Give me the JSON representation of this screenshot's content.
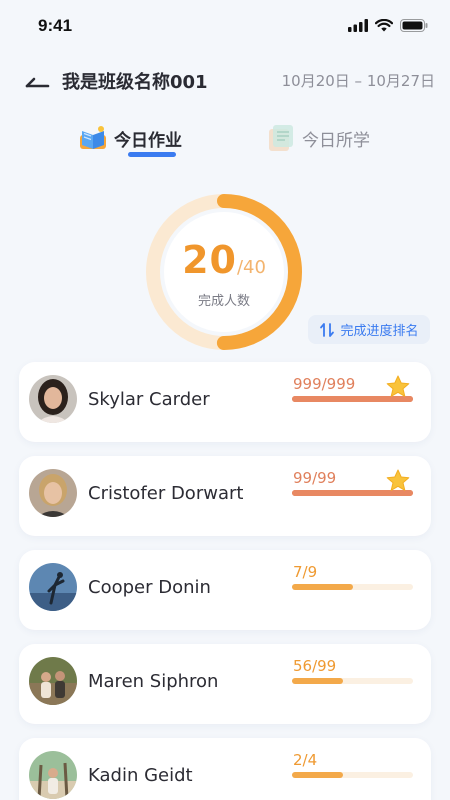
{
  "status": {
    "time": "9:41"
  },
  "header": {
    "class_name": "我是班级名称001",
    "date_range": "10月20日 – 10月27日"
  },
  "tabs": [
    {
      "label": "今日作业",
      "active": true,
      "icon": "book-icon"
    },
    {
      "label": "今日所学",
      "active": false,
      "icon": "notebook-icon"
    }
  ],
  "summary": {
    "completed": "20",
    "total": "/40",
    "caption": "完成人数",
    "completion_fraction": 0.5
  },
  "rank_button": {
    "label": "完成进度排名",
    "icon": "sort-icon"
  },
  "colors": {
    "accent_blue": "#3a7bf0",
    "ring_orange": "#f6a63a",
    "ring_track": "#fbe9d2",
    "complete_bar": "#e88862",
    "progress_bar": "#f3a94a",
    "bar_track": "#fbf0e2",
    "star": "#f9c33b"
  },
  "students": [
    {
      "name": "Skylar Carder",
      "progress": "999/999",
      "fraction": 1.0,
      "complete": true
    },
    {
      "name": "Cristofer Dorwart",
      "progress": "99/99",
      "fraction": 1.0,
      "complete": true
    },
    {
      "name": "Cooper Donin",
      "progress": "7/9",
      "fraction": 0.5,
      "complete": false
    },
    {
      "name": "Maren Siphron",
      "progress": "56/99",
      "fraction": 0.42,
      "complete": false
    },
    {
      "name": "Kadin Geidt",
      "progress": "2/4",
      "fraction": 0.42,
      "complete": false
    }
  ]
}
